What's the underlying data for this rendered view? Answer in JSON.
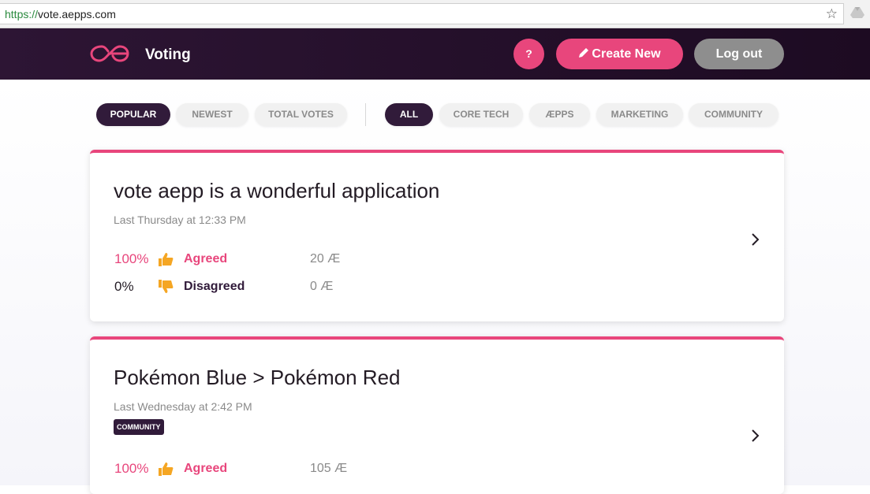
{
  "browser": {
    "url_scheme": "https://",
    "url_host": "vote.aepps.com"
  },
  "header": {
    "title": "Voting",
    "help_label": "?",
    "create_label": "Create New",
    "logout_label": "Log out"
  },
  "filters": {
    "sort": [
      {
        "label": "POPULAR",
        "active": true
      },
      {
        "label": "NEWEST",
        "active": false
      },
      {
        "label": "TOTAL VOTES",
        "active": false
      }
    ],
    "categories": [
      {
        "label": "ALL",
        "active": true
      },
      {
        "label": "CORE TECH",
        "active": false
      },
      {
        "label": "ÆPPS",
        "active": false
      },
      {
        "label": "MARKETING",
        "active": false
      },
      {
        "label": "COMMUNITY",
        "active": false
      }
    ]
  },
  "colors": {
    "accent": "#e8467c",
    "header_bg": "#2d1534",
    "active_pill": "#311b3a",
    "thumb": "#f5a623"
  },
  "polls": [
    {
      "title": "vote aepp is a wonderful application",
      "date": "Last Thursday at 12:33 PM",
      "agree": {
        "percent": "100%",
        "label": "Agreed",
        "amount": "20 Æ"
      },
      "disagree": {
        "percent": "0%",
        "label": "Disagreed",
        "amount": "0 Æ"
      }
    },
    {
      "title": "Pokémon Blue > Pokémon Red",
      "date": "Last Wednesday at 2:42 PM",
      "tag": "COMMUNITY",
      "agree": {
        "percent": "100%",
        "label": "Agreed",
        "amount": "105 Æ"
      }
    }
  ]
}
